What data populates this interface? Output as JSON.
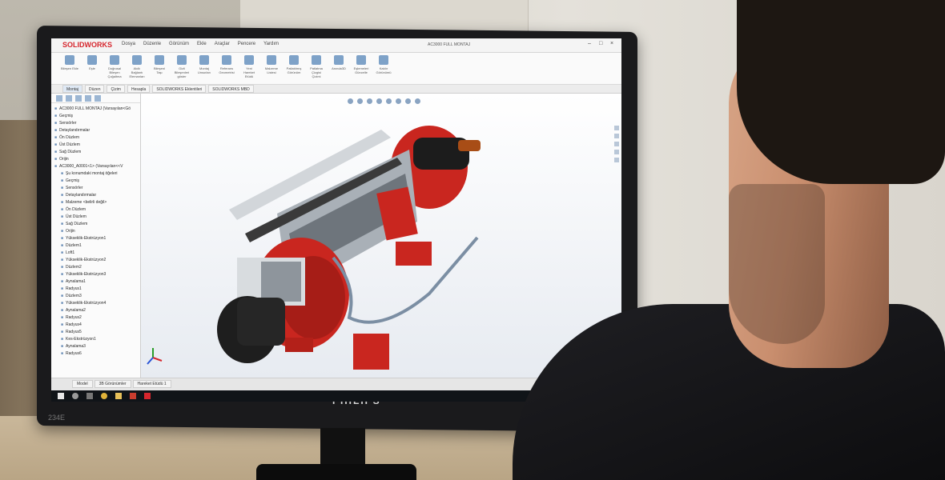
{
  "monitor": {
    "brand": "PHILIPS",
    "model_tag": "234E"
  },
  "app": {
    "logo": "SOLIDWORKS",
    "window_title": "AC3000 FULL MONTAJ",
    "menu": [
      "Dosya",
      "Düzenle",
      "Görünüm",
      "Ekle",
      "Araçlar",
      "Pencere",
      "Yardım"
    ],
    "ribbon_labels": [
      "Bileşen Ekle",
      "Eşle",
      "Doğrusal Bileşen Çoğaltma",
      "Akıllı Bağlantı Elemanları",
      "Bileşeni Taşı",
      "Gizli Bileşenleri göster",
      "Montaj Unsurları",
      "Referans Geometrisi",
      "Yeni Hareket Etüdü",
      "Malzeme Listesi",
      "Patlatılmış Görünüm",
      "Patlatma Çizgisi Çizimi",
      "Anında3D",
      "Eşlemeleri Güncelle",
      "Kaldır Görünümü"
    ],
    "command_tabs": [
      "Montaj",
      "Düzen",
      "Çizim",
      "Hesapla",
      "SOLIDWORKS Eklentileri",
      "SOLIDWORKS MBD"
    ],
    "active_tab": "Montaj",
    "tree_items": [
      "AC3000 FULL MONTAJ (Varsayılan<Gö",
      "Geçmiş",
      "Sensörler",
      "Detaylandırmalar",
      "Ön Düzlem",
      "Üst Düzlem",
      "Sağ Düzlem",
      "Orijin",
      "AC3000_A0001<1> (Varsayılan<<V",
      "Şu konumdaki montaj öğeleri",
      "Geçmiş",
      "Sensörler",
      "Detaylandırmalar",
      "Malzeme <belirli değil>",
      "Ön Düzlem",
      "Üst Düzlem",
      "Sağ Düzlem",
      "Orijin",
      "Yükseklik-Ekstrüzyon1",
      "Düzlem1",
      "Loft1",
      "Yükseklik-Ekstrüzyon2",
      "Düzlem2",
      "Yükseklik-Ekstrüzyon3",
      "Aynalama1",
      "Radyus1",
      "Düzlem3",
      "Yükseklik-Ekstrüzyon4",
      "Aynalama2",
      "Radyus2",
      "Radyus4",
      "Radyus5",
      "Kes-Ekstrüzyon1",
      "Aynalama3",
      "Radyus6"
    ],
    "bottom_tabs": [
      "Model",
      "3B Görünümler",
      "Hareket Etüdü 1"
    ],
    "colors": {
      "accent": "#d6262d",
      "model_red": "#c9261f",
      "model_grey": "#9aa3ab"
    }
  }
}
